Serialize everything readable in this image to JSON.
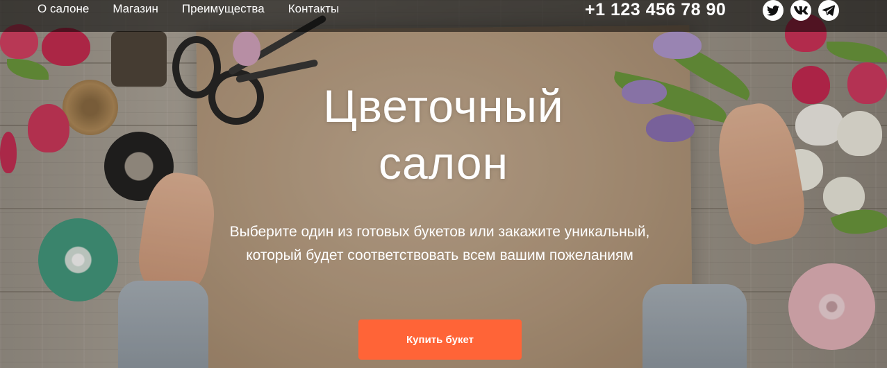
{
  "nav": {
    "items": [
      {
        "label": "О салоне"
      },
      {
        "label": "Магазин"
      },
      {
        "label": "Преимущества"
      },
      {
        "label": "Контакты"
      }
    ],
    "phone": "+1 123 456 78 90",
    "socials": [
      {
        "icon": "twitter-icon"
      },
      {
        "icon": "vk-icon"
      },
      {
        "icon": "telegram-icon"
      }
    ]
  },
  "hero": {
    "title_line1": "Цветочный",
    "title_line2": "салон",
    "subtitle_line1": "Выберите один из готовых букетов или закажите уникальный,",
    "subtitle_line2": "который будет соответствовать всем вашим пожеланиям",
    "cta_label": "Купить букет"
  },
  "colors": {
    "accent": "#ff6437",
    "navbar_bg": "rgba(0,0,0,0.55)",
    "text": "#ffffff"
  }
}
